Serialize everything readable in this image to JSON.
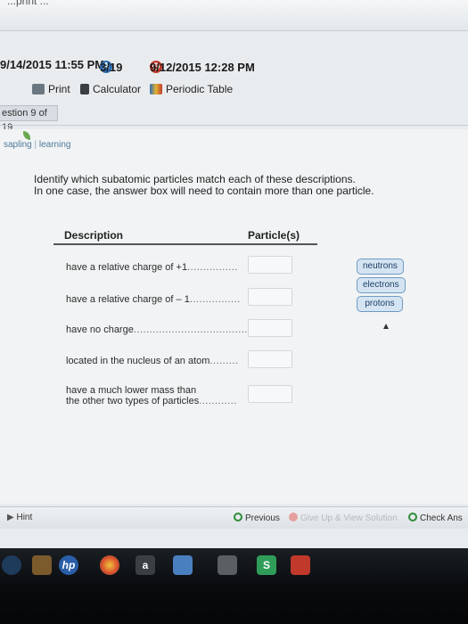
{
  "header": {
    "cut_title": "...print ...",
    "start_time": "9/14/2015 11:55 PM",
    "score_badge": "A",
    "score": "3/19",
    "due_time": "9/12/2015 12:28 PM"
  },
  "toolbar": {
    "print_label": "Print",
    "calculator_label": "Calculator",
    "periodic_table_label": "Periodic Table"
  },
  "question_number": "estion 9 of 19",
  "logo": {
    "text_a": "sapling",
    "text_b": "learning"
  },
  "prompt": {
    "line1": "Identify which subatomic particles match each of these descriptions.",
    "line2": "In one case, the answer box will need to contain more than one particle."
  },
  "table": {
    "col_description": "Description",
    "col_particles": "Particle(s)",
    "rows": [
      {
        "text": "have a relative charge of +1",
        "dots": "................"
      },
      {
        "text": "have a relative charge of – 1",
        "dots": "................"
      },
      {
        "text": "have no charge",
        "dots": ".............................................."
      },
      {
        "text": "located in the nucleus of an atom",
        "dots": "........."
      },
      {
        "text": "have a much lower mass than",
        "text2": "the other two types of particles",
        "dots": "............"
      }
    ]
  },
  "choices": [
    "neutrons",
    "electrons",
    "protons"
  ],
  "controls": {
    "hint": "Hint",
    "previous": "Previous",
    "give_up": "Give Up & View Solution",
    "check": "Check Ans"
  },
  "taskbar": {
    "hp": "hp",
    "amazon": "a"
  },
  "colors": {
    "chip_bg": "#d4e4f2",
    "chip_border": "#6f9bc4",
    "taskbar": "#0b0d10"
  }
}
